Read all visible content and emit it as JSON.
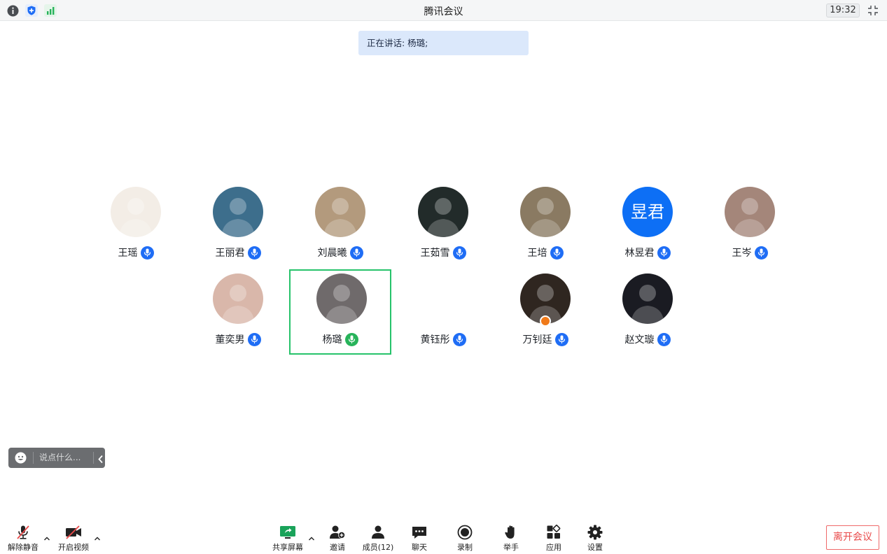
{
  "window": {
    "title": "腾讯会议",
    "clock": "19:32"
  },
  "speaking": {
    "text": "正在讲话: 杨璐;"
  },
  "participants": [
    {
      "name": "王瑶",
      "mic": "muted",
      "avatar_icon": "cartoon-baby-avatar",
      "avatar_bg": "#f3ede6"
    },
    {
      "name": "王丽君",
      "mic": "muted",
      "avatar_icon": "tree-sky-photo-avatar",
      "avatar_bg": "#3d6e8c"
    },
    {
      "name": "刘晨曦",
      "mic": "muted",
      "avatar_icon": "card-photo-avatar",
      "avatar_bg": "#b39a7d"
    },
    {
      "name": "王茹雪",
      "mic": "muted",
      "avatar_icon": "portrait-photo-avatar",
      "avatar_bg": "#222b2a"
    },
    {
      "name": "王培",
      "mic": "muted",
      "avatar_icon": "child-photo-avatar",
      "avatar_bg": "#8a7a62"
    },
    {
      "name": "林昱君",
      "mic": "muted",
      "avatar_icon": "initials-avatar",
      "avatar_text": "昱君",
      "avatar_bg": "#0d6ff5"
    },
    {
      "name": "王岑",
      "mic": "muted",
      "avatar_icon": "portrait-photo-avatar",
      "avatar_bg": "#a4867a"
    },
    {
      "name": "董奕男",
      "mic": "muted",
      "avatar_icon": "baby-photo-avatar",
      "avatar_bg": "#d9b7aa"
    },
    {
      "name": "杨璐",
      "mic": "speaking",
      "avatar_icon": "microphone-photo-avatar",
      "avatar_bg": "#6f6a6b"
    },
    {
      "name": "黄钰彤",
      "mic": "muted",
      "avatar_icon": "cartoon-duck-avatar",
      "avatar_bg": "#ffffff"
    },
    {
      "name": "万钊廷",
      "mic": "muted",
      "avatar_icon": "dark-photo-avatar",
      "avatar_bg": "#2f2620",
      "host": true
    },
    {
      "name": "赵文璇",
      "mic": "muted",
      "avatar_icon": "night-photo-avatar",
      "avatar_bg": "#1a1b22"
    }
  ],
  "chat": {
    "placeholder": "说点什么..."
  },
  "toolbar": {
    "unmute": "解除静音",
    "video": "开启视频",
    "share": "共享屏幕",
    "invite": "邀请",
    "members": "成员(12)",
    "chat": "聊天",
    "record": "录制",
    "raise_hand": "举手",
    "apps": "应用",
    "settings": "设置",
    "leave": "离开会议"
  },
  "colors": {
    "accent": "#1f6df5",
    "speaking": "#27c36b",
    "leave": "#e94a4a",
    "share_green": "#1aa35a"
  }
}
